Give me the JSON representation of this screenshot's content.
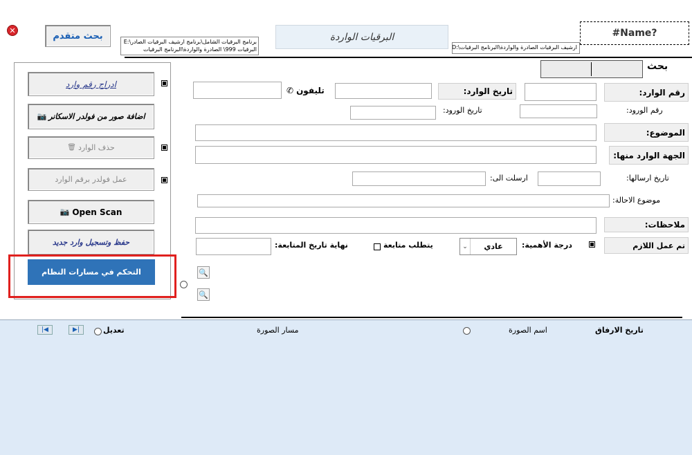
{
  "top": {
    "advanced_search": "بحث متقدم",
    "path_left": "برنامج البرقيات الشامل\\برنامج ارشيف البرقيات الصادر\\:E",
    "path_left_line2": "البرقيات 999\\ الصادرة والواردة\\البرنامج البرقيات",
    "section_title": "البرقيات الواردة",
    "path_right": "ارشيف البرقيات الصادرة والواردة\\البرنامج البرقيات\\:D",
    "name_error": "#Name?"
  },
  "sidebar": {
    "insert_number": "ادراج رقم وارد",
    "add_images": "اضافة صور من فولدر الاسكانر",
    "delete_incoming": "حذف الوارد",
    "make_folder": "عمل فولدر برقم الوارد",
    "open_scan": "Open Scan",
    "save_new": "حفظ وتسجيل وارد جديد",
    "system_paths": "التحكم في مسارات النظام"
  },
  "form": {
    "search_label": "بحث",
    "incoming_no_label": "رقم الوارد:",
    "incoming_date_label": "تاريخ الوارد:",
    "phone_label": "تليفون",
    "arrival_no_label": "رقم الورود:",
    "arrival_date_label": "تاريخ الورود:",
    "subject_label": "الموضوع:",
    "sender_label": "الجهة الوارد منها:",
    "sent_date_label": "تاريخ ارسالها:",
    "sent_to_label": "ارسلت الى:",
    "referral_subject_label": "موضوع الاحالة:",
    "notes_label": "ملاحظات:",
    "done_label": "تم عمل اللازم",
    "importance_label": "درجة الأهمية:",
    "importance_value": "عادي",
    "followup_label": "يتطلب متابعة",
    "followup_end_label": "نهاية تاريخ المتابعة:"
  },
  "attachments": {
    "date_col": "تاريخ الارفاق",
    "image_name_col": "اسم الصورة",
    "image_path_col": "مسار الصورة",
    "edit_col": "تعديل"
  },
  "colors": {
    "accent_blue": "#2f73b8",
    "highlight_red": "#e0201e",
    "subform_bg": "#deeaf7",
    "title_bg": "#e9f1f8"
  }
}
